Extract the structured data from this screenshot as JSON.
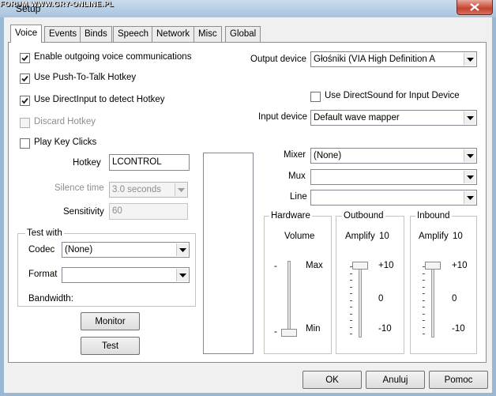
{
  "window": {
    "watermark": "FORUM WWW.GRY-ONLINE.PL",
    "title": "Setup"
  },
  "tabs": [
    "Voice",
    "Events",
    "Binds",
    "Speech",
    "Network",
    "Misc",
    "Global"
  ],
  "voice": {
    "enable_outgoing": "Enable outgoing voice communications",
    "push_to_talk": "Use Push-To-Talk Hotkey",
    "directinput": "Use DirectInput to detect Hotkey",
    "discard_hotkey": "Discard Hotkey",
    "play_key_clicks": "Play Key Clicks",
    "hotkey_label": "Hotkey",
    "hotkey_value": "LCONTROL",
    "silence_label": "Silence time",
    "silence_value": "3.0 seconds",
    "sensitivity_label": "Sensitivity",
    "sensitivity_value": "60",
    "test_with": {
      "title": "Test with",
      "codec_label": "Codec",
      "codec_value": "(None)",
      "format_label": "Format",
      "format_value": "",
      "bandwidth_label": "Bandwidth:"
    },
    "monitor_button": "Monitor",
    "test_button": "Test",
    "output_device_label": "Output device",
    "output_device_value": "Głośniki (VIA High Definition A",
    "use_directsound": "Use DirectSound for Input Device",
    "input_device_label": "Input device",
    "input_device_value": "Default wave mapper",
    "mixer_label": "Mixer",
    "mixer_value": "(None)",
    "mux_label": "Mux",
    "mux_value": "",
    "line_label": "Line",
    "line_value": "",
    "hardware": {
      "title": "Hardware",
      "volume_label": "Volume",
      "max_label": "Max",
      "min_label": "Min",
      "dash": "-",
      "level": 0.0
    },
    "outbound": {
      "title": "Outbound",
      "amplify_label": "Amplify",
      "amplify_value": "10",
      "plus": "+10",
      "zero": "0",
      "minus": "-10"
    },
    "inbound": {
      "title": "Inbound",
      "amplify_label": "Amplify",
      "amplify_value": "10",
      "plus": "+10",
      "zero": "0",
      "minus": "-10"
    }
  },
  "footer": {
    "ok": "OK",
    "cancel": "Anuluj",
    "help": "Pomoc"
  },
  "checks": {
    "enable_outgoing": true,
    "push_to_talk": true,
    "directinput": true,
    "discard_hotkey": false,
    "play_key_clicks": false,
    "use_directsound": false
  },
  "colors": {
    "title_bar": "#a8c3dd",
    "close_button": "#c4412f",
    "dialog_bg": "#f0f0f0",
    "panel_bg": "#ffffff",
    "disabled_text": "#8d8d8d"
  }
}
